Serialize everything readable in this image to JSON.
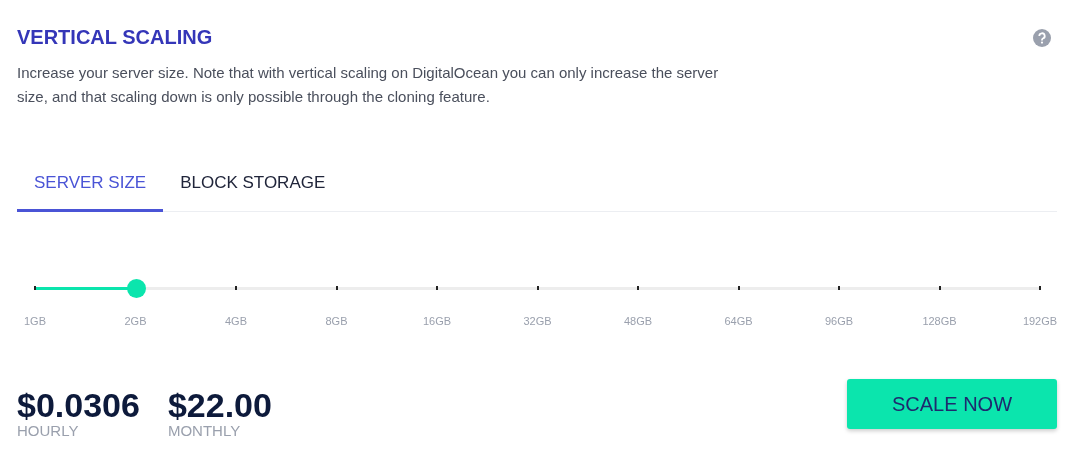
{
  "section": {
    "title": "VERTICAL SCALING",
    "description": "Increase your server size. Note that with vertical scaling on DigitalOcean you can only increase the server size, and that scaling down is only possible through the cloning feature."
  },
  "tabs": [
    {
      "label": "SERVER SIZE",
      "selected": true
    },
    {
      "label": "BLOCK STORAGE",
      "selected": false
    }
  ],
  "slider": {
    "level": 0.1,
    "stops": [
      "1GB",
      "2GB",
      "4GB",
      "8GB",
      "16GB",
      "32GB",
      "48GB",
      "64GB",
      "96GB",
      "128GB",
      "192GB"
    ]
  },
  "prices": [
    {
      "amount": "$0.0306",
      "period": "HOURLY"
    },
    {
      "amount": "$22.00",
      "period": "MONTHLY"
    }
  ],
  "action": {
    "label": "SCALE NOW"
  }
}
